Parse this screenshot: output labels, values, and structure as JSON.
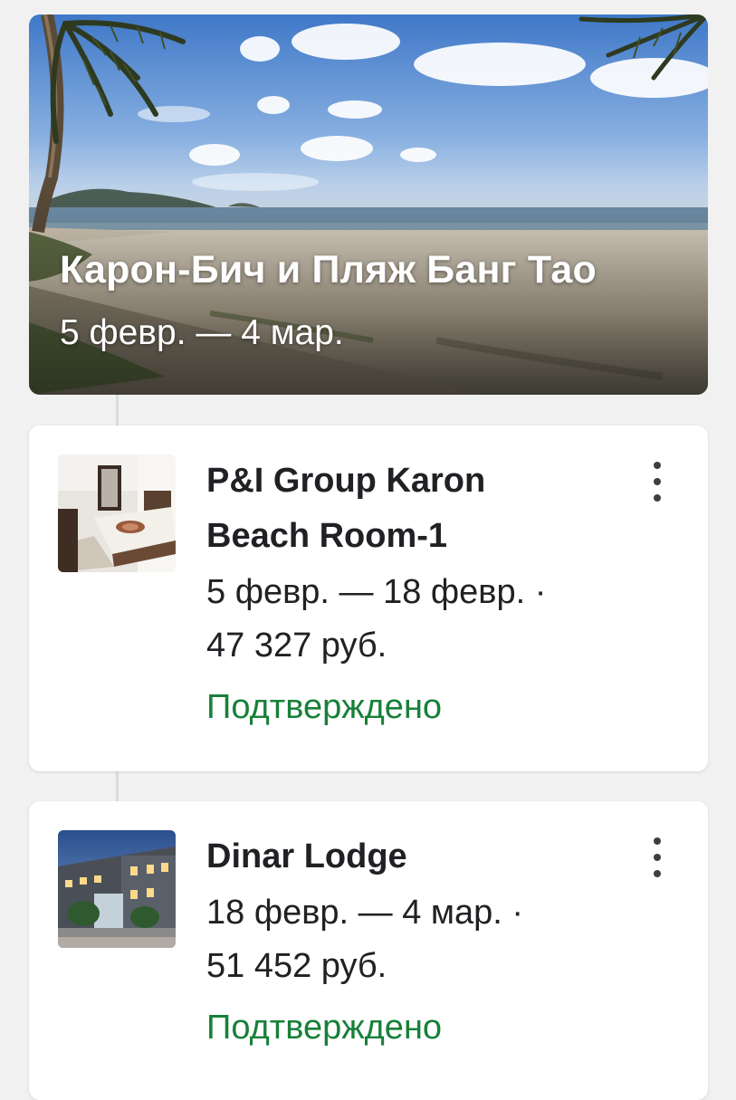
{
  "destination": {
    "title": "Карон-Бич и Пляж Банг Тао",
    "dates": "5 февр. — 4 мар."
  },
  "stays": [
    {
      "title_line1": "P&I Group Karon",
      "title_line2": "Beach Room-1",
      "dates_line": "5 февр. — 18 февр. ·",
      "price": "47 327 руб.",
      "status": "Подтверждено"
    },
    {
      "title_line1": "Dinar Lodge",
      "dates_line": "18 февр. — 4 мар. ·",
      "price": "51 452 руб.",
      "status": "Подтверждено"
    }
  ],
  "colors": {
    "status_confirmed": "#188038",
    "text_primary": "#202124",
    "background": "#f1f1f1"
  },
  "icons": {
    "card_menu": "more-vert-icon"
  }
}
